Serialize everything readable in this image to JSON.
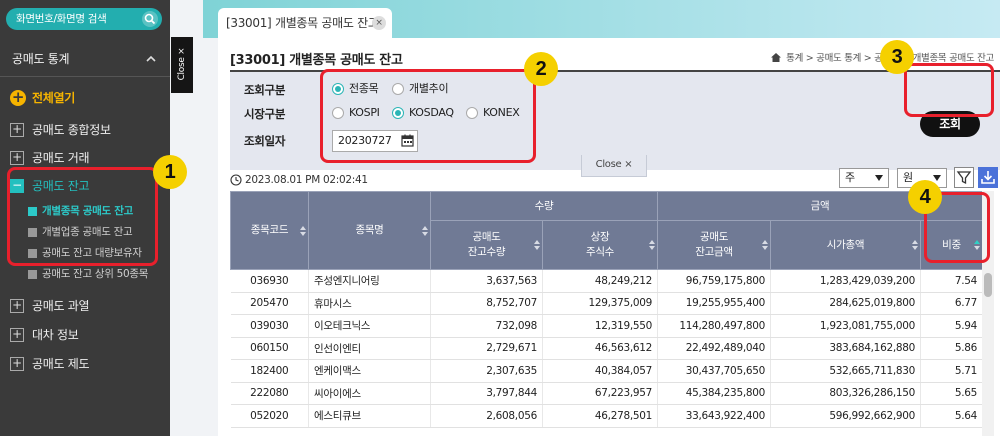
{
  "sidebar": {
    "search_label": "화면번호/화면명 검색",
    "menu_title": "공매도 통계",
    "expand_all": "전체열기",
    "items": [
      {
        "label": "공매도 종합정보",
        "icon": "+"
      },
      {
        "label": "공매도 거래",
        "icon": "+"
      },
      {
        "label": "공매도 잔고",
        "icon": "−"
      },
      {
        "label": "공매도 과열",
        "icon": "+"
      },
      {
        "label": "대차 정보",
        "icon": "+"
      },
      {
        "label": "공매도 제도",
        "icon": "+"
      }
    ],
    "subitems": [
      {
        "label": "개별종목 공매도 잔고"
      },
      {
        "label": "개별업종 공매도 잔고"
      },
      {
        "label": "공매도 잔고 대량보유자"
      },
      {
        "label": "공매도 잔고 상위 50종목"
      }
    ],
    "close_label": "Close ×"
  },
  "tab": {
    "label": "[33001] 개별종목 공매도 잔고",
    "close": "×"
  },
  "page": {
    "title": "[33001] 개별종목 공매도 잔고",
    "breadcrumb": "통계  >  공매도 통계  >  공매도  >  개별종목 공매도 잔고"
  },
  "form": {
    "query_type_label": "조회구분",
    "query_type_options": [
      "전종목",
      "개별추이"
    ],
    "market_label": "시장구분",
    "market_options": [
      "KOSPI",
      "KOSDAQ",
      "KONEX"
    ],
    "date_label": "조회일자",
    "date_value": "20230727",
    "search_button": "조회",
    "close_label": "Close  ×"
  },
  "toolbar": {
    "timestamp": "2023.08.01 PM 02:02:41",
    "unit_select": "주",
    "currency_select": "원"
  },
  "table": {
    "headers": {
      "code": "종목코드",
      "name": "종목명",
      "qty_group": "수량",
      "amt_group": "금액",
      "short_qty": "공매도\n잔고수량",
      "listed_shares": "상장\n주식수",
      "short_amt": "공매도\n잔고금액",
      "market_cap": "시가총액",
      "ratio": "비중"
    },
    "rows": [
      [
        "036930",
        "주성엔지니어링",
        "3,637,563",
        "48,249,212",
        "96,759,175,800",
        "1,283,429,039,200",
        "7.54"
      ],
      [
        "205470",
        "휴마시스",
        "8,752,707",
        "129,375,009",
        "19,255,955,400",
        "284,625,019,800",
        "6.77"
      ],
      [
        "039030",
        "이오테크닉스",
        "732,098",
        "12,319,550",
        "114,280,497,800",
        "1,923,081,755,000",
        "5.94"
      ],
      [
        "060150",
        "인선이엔티",
        "2,729,671",
        "46,563,612",
        "22,492,489,040",
        "383,684,162,880",
        "5.86"
      ],
      [
        "182400",
        "엔케이맥스",
        "2,307,635",
        "40,384,057",
        "30,437,705,650",
        "532,665,711,830",
        "5.71"
      ],
      [
        "222080",
        "씨아이에스",
        "3,797,844",
        "67,223,957",
        "45,384,235,800",
        "803,326,286,150",
        "5.65"
      ],
      [
        "052020",
        "에스티큐브",
        "2,608,056",
        "46,278,501",
        "33,643,922,400",
        "596,992,662,900",
        "5.64"
      ]
    ]
  },
  "annotations": [
    "1",
    "2",
    "3",
    "4"
  ],
  "colors": {
    "accent": "#23aeaf",
    "highlight": "#e8202c",
    "badge": "#f5d000",
    "table_header": "#707a95"
  }
}
